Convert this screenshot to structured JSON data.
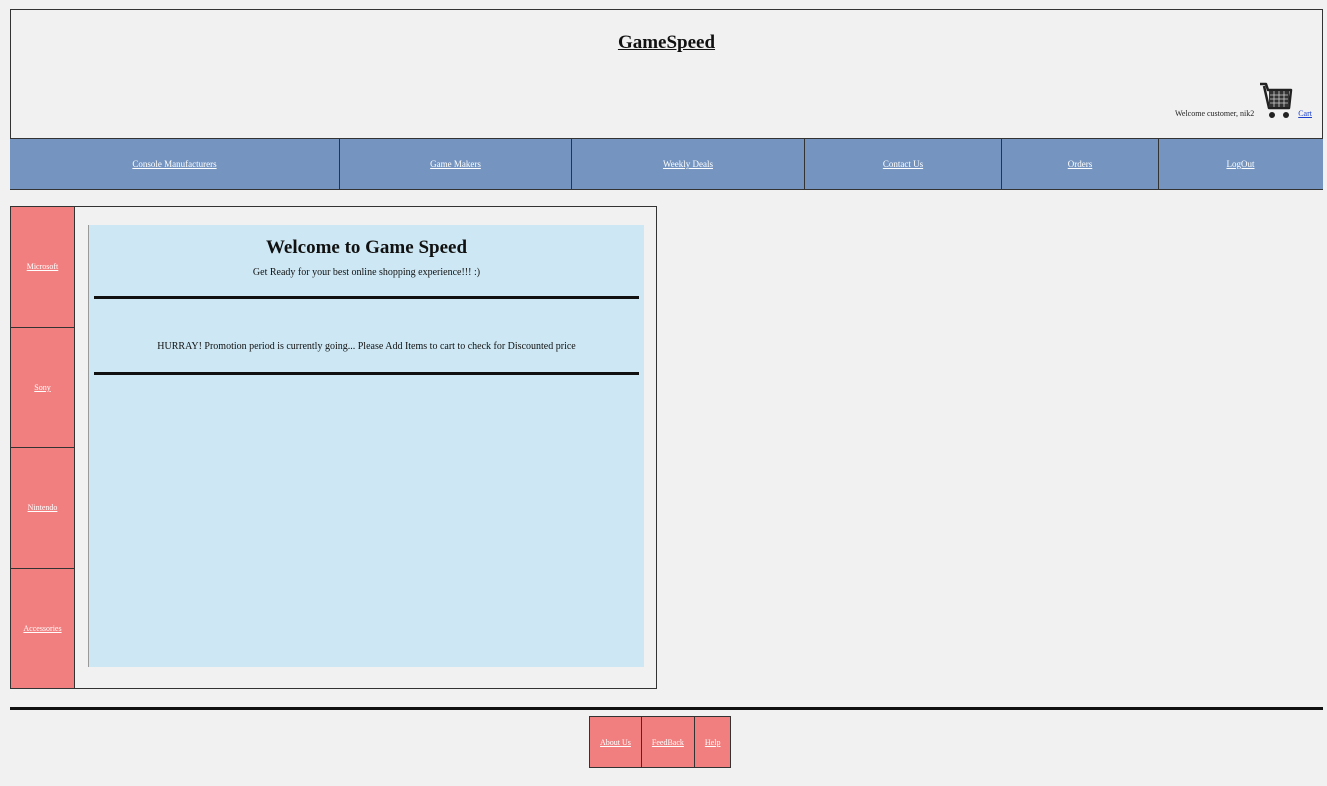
{
  "header": {
    "site_title": "GameSpeed",
    "welcome_text": "Welcome customer, nik2",
    "cart_label": "Cart",
    "cart_icon": "shopping-cart-icon"
  },
  "nav": {
    "items": [
      {
        "label": "Console Manufacturers"
      },
      {
        "label": "Game Makers"
      },
      {
        "label": "Weekly Deals"
      },
      {
        "label": "Contact Us"
      },
      {
        "label": "Orders"
      },
      {
        "label": "LogOut"
      }
    ]
  },
  "sidebar": {
    "items": [
      {
        "label": "Microsoft"
      },
      {
        "label": "Sony"
      },
      {
        "label": "Nintendo"
      },
      {
        "label": "Accessories"
      }
    ]
  },
  "main": {
    "title": "Welcome to Game Speed",
    "subtitle": "Get Ready for your best online shopping experience!!! :)",
    "promo": "HURRAY! Promotion period is currently going... Please Add Items to cart to check for Discounted price"
  },
  "footer": {
    "items": [
      {
        "label": "About Us"
      },
      {
        "label": "FeedBack"
      },
      {
        "label": "Help"
      }
    ]
  },
  "colors": {
    "nav_bg": "#7595c0",
    "sidebar_bg": "#f27f7f",
    "content_bg": "#cde8f4",
    "page_bg": "#f1f1f1"
  }
}
